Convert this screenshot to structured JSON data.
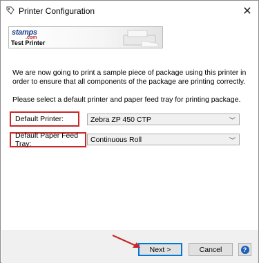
{
  "window": {
    "title": "Printer Configuration",
    "close_icon": "close-icon",
    "app_icon": "printer-wrench-icon"
  },
  "banner": {
    "logo_text": "stamps",
    "logo_suffix": ".com",
    "subtitle": "Test Printer"
  },
  "body": {
    "intro": "We are now going to print a sample piece of package using this printer in order to ensure that all components of the package are printing correctly.",
    "instruction": "Please select a default printer and paper feed tray for printing package."
  },
  "fields": {
    "printer_label": "Default Printer:",
    "printer_value": "Zebra ZP 450 CTP",
    "tray_label": "Default Paper Feed Tray:",
    "tray_value": "Continuous Roll"
  },
  "footer": {
    "next_label": "Next >",
    "cancel_label": "Cancel",
    "help_label": "?"
  },
  "colors": {
    "highlight": "#c62828",
    "accent": "#0078d7",
    "logo_blue": "#1a3d8a"
  }
}
